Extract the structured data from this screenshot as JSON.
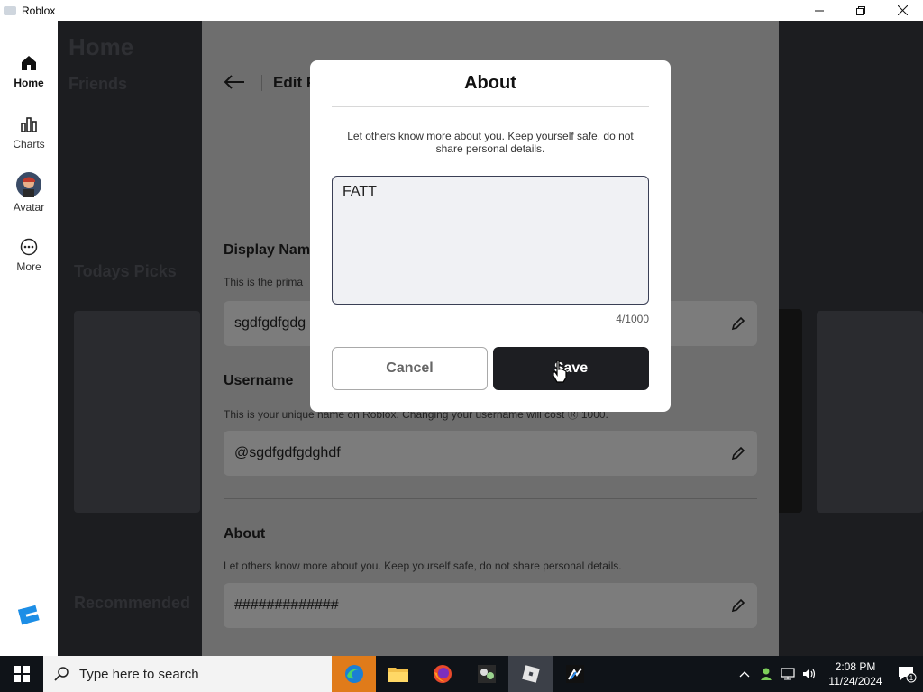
{
  "window": {
    "title": "Roblox",
    "controls": [
      "minimize",
      "restore",
      "close"
    ]
  },
  "sidebar": {
    "items": [
      {
        "label": "Home",
        "icon": "home-icon",
        "active": true
      },
      {
        "label": "Charts",
        "icon": "charts-icon",
        "active": false
      },
      {
        "label": "Avatar",
        "icon": "avatar-icon",
        "active": false
      },
      {
        "label": "More",
        "icon": "more-icon",
        "active": false
      }
    ]
  },
  "background": {
    "page_title": "Home",
    "friends": "Friends",
    "todays_picks": "Todays Picks",
    "recommended": "Recommended"
  },
  "edit_profile": {
    "title": "Edit P",
    "display_name": {
      "title": "Display Nam",
      "desc": "This is the prima",
      "value": "sgdfgdfgdg"
    },
    "username": {
      "title": "Username",
      "desc": "This is your unique name on Roblox. Changing your username will cost Ⓡ 1000.",
      "value": "@sgdfgdfgdghdf"
    },
    "about": {
      "title": "About",
      "desc": "Let others know more about you. Keep yourself safe, do not share personal details.",
      "value": "#############"
    }
  },
  "modal": {
    "title": "About",
    "description": "Let others know more about you. Keep yourself safe, do not share personal details.",
    "text_value": "FATT",
    "counter": "4/1000",
    "cancel_label": "Cancel",
    "save_label": "Save"
  },
  "taskbar": {
    "search_placeholder": "Type here to search",
    "apps": [
      "edge-icon",
      "file-explorer-icon",
      "firefox-icon",
      "game-app-icon",
      "roblox-icon",
      "roblox-studio-icon"
    ],
    "time": "2:08 PM",
    "date": "11/24/2024",
    "notification_count": "1"
  },
  "colors": {
    "accent_dark": "#1d1e22",
    "panel_dim": "#6e6e6e",
    "taskbar": "#0f1318"
  }
}
